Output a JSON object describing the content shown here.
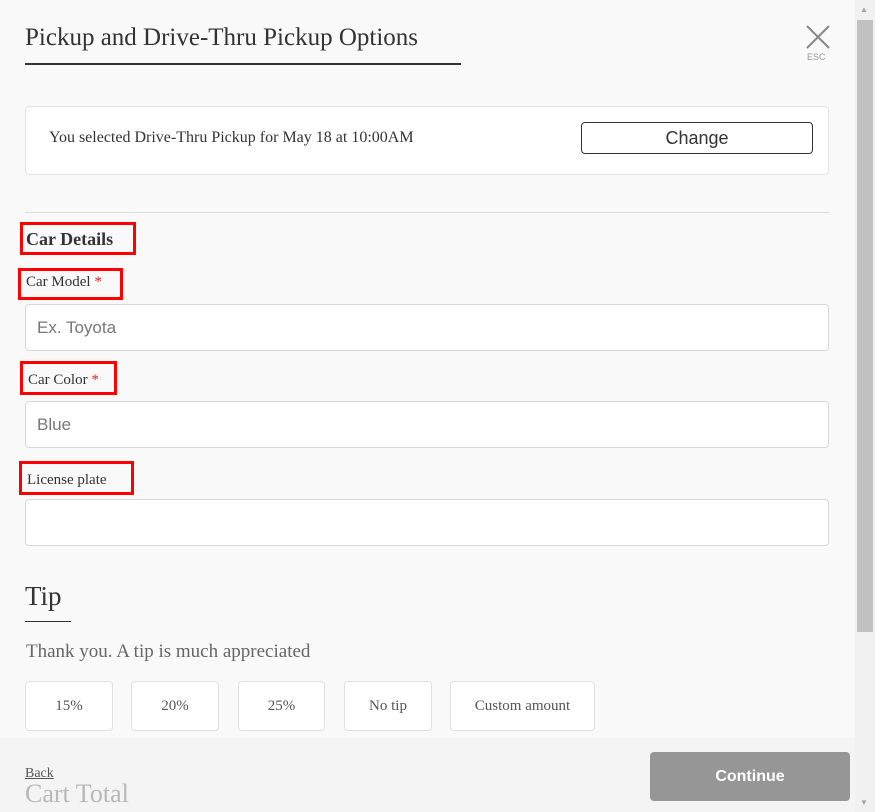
{
  "header": {
    "title": "Pickup and Drive-Thru Pickup Options",
    "close_icon": "close-x-icon",
    "esc_label": "ESC"
  },
  "selection": {
    "text": "You selected Drive-Thru Pickup for May 18 at 10:00AM",
    "change_label": "Change"
  },
  "car_details": {
    "heading": "Car Details",
    "required_marker": "*",
    "fields": [
      {
        "label": "Car Model",
        "required": true,
        "placeholder": "Ex. Toyota",
        "value": ""
      },
      {
        "label": "Car Color",
        "required": true,
        "placeholder": "Blue",
        "value": ""
      },
      {
        "label": "License plate",
        "required": false,
        "placeholder": "",
        "value": ""
      }
    ]
  },
  "tip": {
    "heading": "Tip",
    "subtitle": "Thank you. A tip is much appreciated",
    "options": [
      "15%",
      "20%",
      "25%",
      "No tip",
      "Custom amount"
    ]
  },
  "cart_total_heading": "Cart Total",
  "footer": {
    "back_label": "Back",
    "continue_label": "Continue"
  },
  "colors": {
    "highlight": "#ff0000",
    "required": "#e02020",
    "continue_bg": "#969696"
  }
}
